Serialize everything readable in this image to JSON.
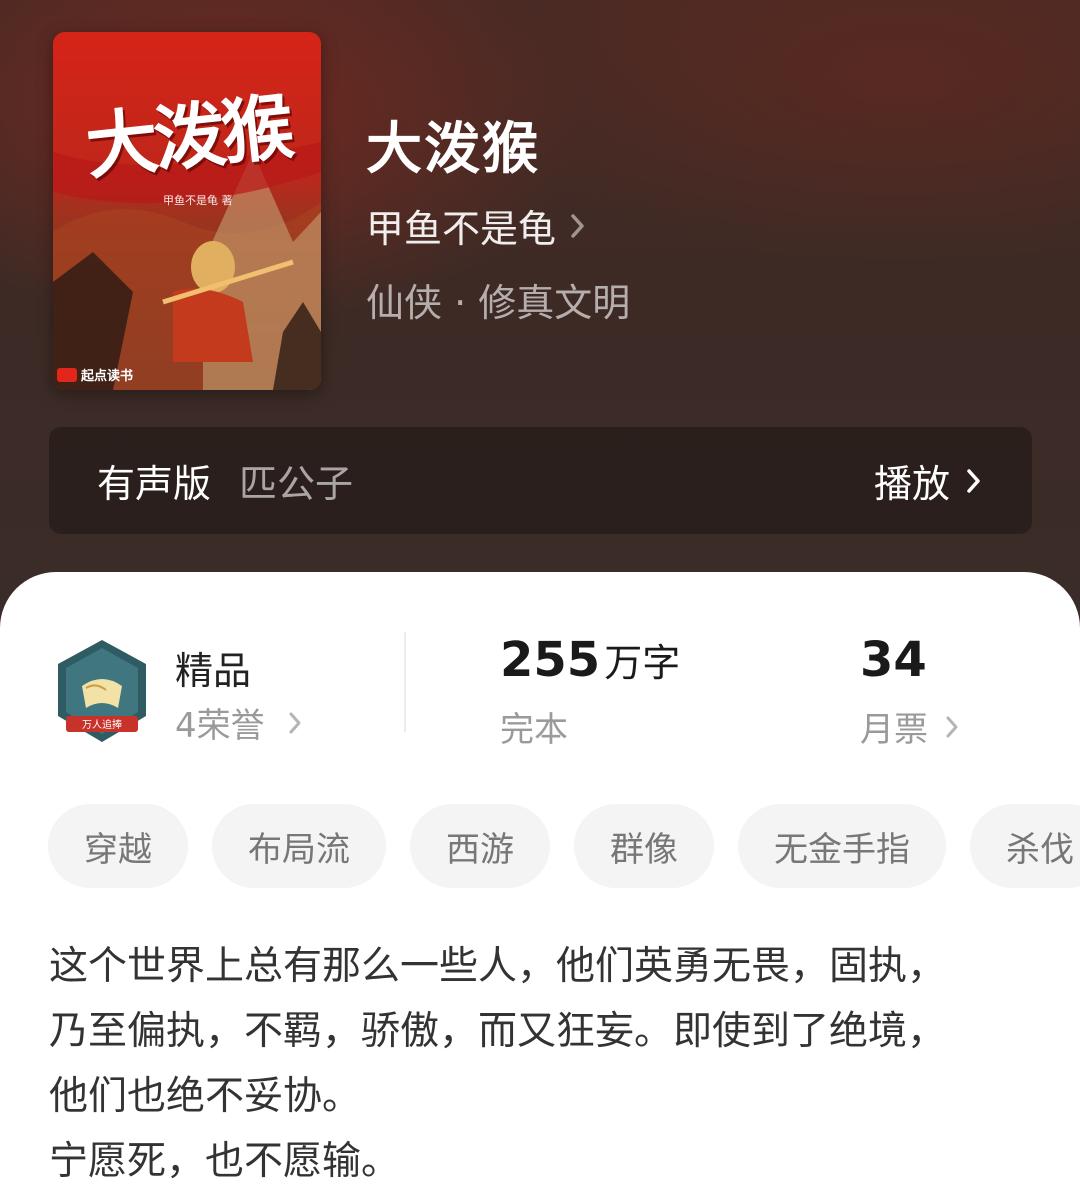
{
  "book": {
    "title": "大泼猴",
    "cover_title": "大泼猴",
    "cover_subtitle": "甲鱼不是龟 著",
    "cover_publisher": "起点读书",
    "author": "甲鱼不是龟",
    "genre": "仙侠 · 修真文明"
  },
  "audio": {
    "label": "有声版",
    "narrator": "匹公子",
    "play_label": "播放"
  },
  "stats": {
    "honor_title": "精品",
    "honor_sub": "4荣誉",
    "medal_text": "万人追捧",
    "words_value": "255",
    "words_unit": "万字",
    "words_sub": "完本",
    "tickets_value": "34",
    "tickets_sub": "月票"
  },
  "tags": [
    "穿越",
    "布局流",
    "西游",
    "群像",
    "无金手指",
    "杀伐"
  ],
  "description": [
    "这个世界上总有那么一些人，他们英勇无畏，固执，",
    "乃至偏执，不羁，骄傲，而又狂妄。即使到了绝境，",
    "他们也绝不妥协。",
    "宁愿死，也不愿输。"
  ],
  "colors": {
    "header_bg": "#3d2a25",
    "cover_red": "#d62418",
    "text_primary": "#1a1a1a",
    "text_muted": "#9a9a9a",
    "tag_bg": "#f4f4f4"
  },
  "icons": {
    "author_link": "chevron-right-icon",
    "play_link": "chevron-right-icon",
    "honor_link": "chevron-right-icon",
    "tickets_link": "chevron-right-icon",
    "medal": "honor-medal-icon"
  }
}
